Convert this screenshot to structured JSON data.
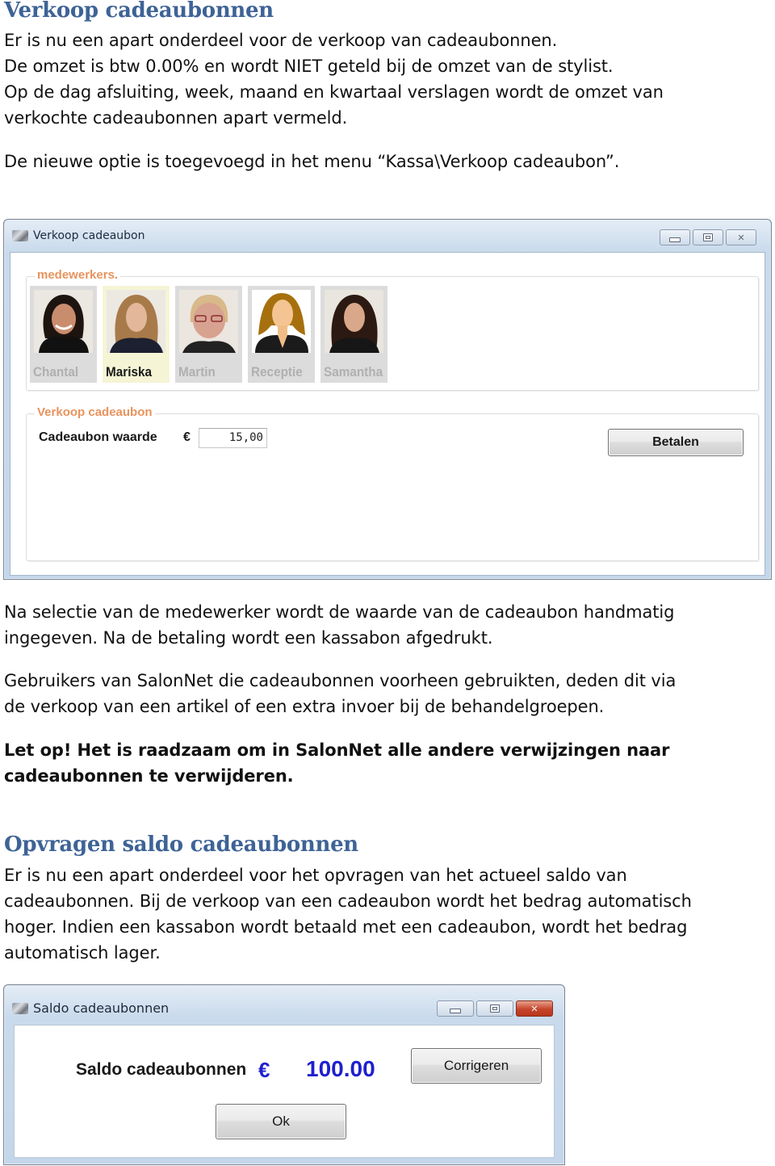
{
  "section1": {
    "heading": "Verkoop cadeaubonnen",
    "intro_lines": [
      "Er is nu een apart onderdeel voor de verkoop van cadeaubonnen.",
      "De omzet is btw 0.00% en wordt NIET geteld bij de omzet van de stylist.",
      "Op de dag afsluiting, week, maand en kwartaal verslagen wordt de omzet van",
      "verkochte cadeaubonnen apart vermeld."
    ],
    "menu_note": "De nieuwe optie is toegevoegd in het menu “Kassa\\Verkoop cadeaubon”.",
    "after_lines": [
      "Na selectie van de medewerker wordt de waarde van de cadeaubon handmatig",
      "ingegeven. Na de betaling wordt een kassabon afgedrukt."
    ],
    "users_lines": [
      "Gebruikers van SalonNet die cadeaubonnen voorheen gebruikten, deden dit via",
      "de verkoop van een artikel of een extra invoer bij de behandelgroepen."
    ],
    "warning_lines": [
      "Let op! Het is raadzaam om in SalonNet alle andere verwijzingen naar",
      "cadeaubonnen te verwijderen."
    ]
  },
  "window_verkoop": {
    "title": "Verkoop cadeaubon",
    "staff_group_label": "medewerkers.",
    "staff": [
      {
        "name": "Chantal",
        "selected": false
      },
      {
        "name": "Mariska",
        "selected": true
      },
      {
        "name": "Martin",
        "selected": false
      },
      {
        "name": "Receptie",
        "selected": false
      },
      {
        "name": "Samantha",
        "selected": false
      }
    ],
    "sale_group_label": "Verkoop cadeaubon",
    "value_label": "Cadeaubon waarde",
    "currency": "€",
    "value": "15,00",
    "pay_button": "Betalen"
  },
  "section2": {
    "heading": "Opvragen saldo cadeaubonnen",
    "lines": [
      "Er is nu een apart onderdeel voor het opvragen van het actueel saldo van",
      "cadeaubonnen. Bij de verkoop van een cadeaubon wordt het bedrag automatisch",
      "hoger. Indien een kassabon wordt betaald met een cadeaubon, wordt het bedrag",
      "automatisch lager."
    ]
  },
  "window_saldo": {
    "title": "Saldo cadeaubonnen",
    "label": "Saldo cadeaubonnen",
    "currency": "€",
    "value": "100.00",
    "correct_button": "Corrigeren",
    "ok_button": "Ok"
  },
  "colors": {
    "heading": "#3e6396",
    "group_label": "#e8935e",
    "saldo_value": "#1f1fcf"
  }
}
